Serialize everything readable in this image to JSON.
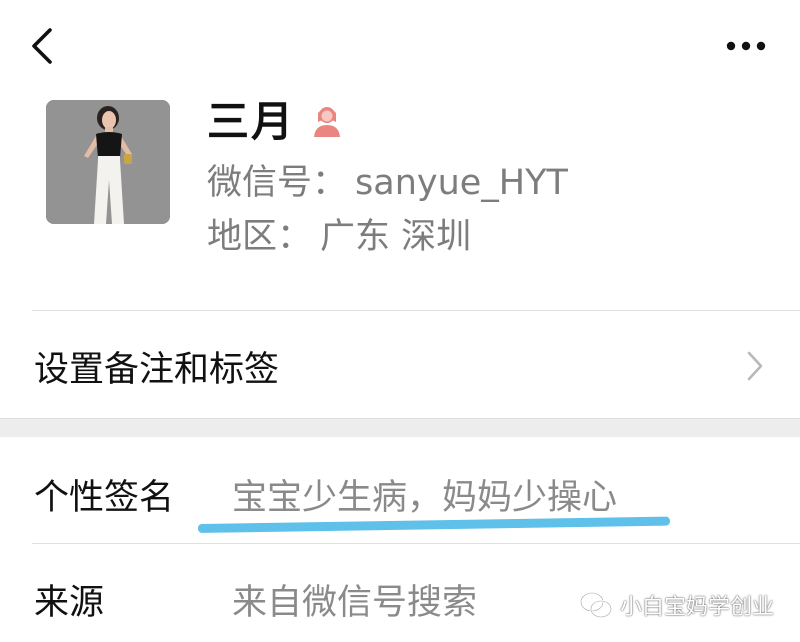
{
  "nav": {
    "back_icon": "chevron-left-icon",
    "more_icon": "more-horizontal-icon"
  },
  "profile": {
    "name": "三月",
    "gender_icon": "female-icon",
    "gender_color": "#e8867f",
    "wechat_id_label": "微信号：",
    "wechat_id": "sanyue_HYT",
    "region_label": "地区：",
    "region": "广东 深圳"
  },
  "remark": {
    "label": "设置备注和标签",
    "arrow_icon": "chevron-right-icon"
  },
  "signature": {
    "label": "个性签名",
    "value": "宝宝少生病，妈妈少操心",
    "highlight_color": "#5fc0ea"
  },
  "source": {
    "label": "来源",
    "value": "来自微信号搜索"
  },
  "watermark": {
    "text": "小白宝妈学创业",
    "icon": "wechat-official-account-icon"
  }
}
